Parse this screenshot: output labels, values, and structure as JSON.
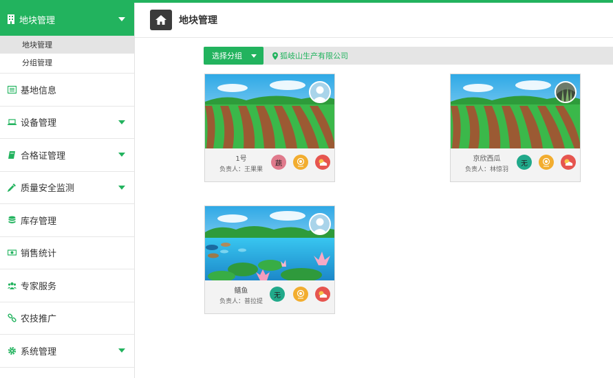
{
  "sidebar": {
    "active": {
      "label": "地块管理",
      "icon": "building-icon"
    },
    "submenu": [
      {
        "label": "地块管理"
      },
      {
        "label": "分组管理"
      }
    ],
    "items": [
      {
        "label": "基地信息",
        "icon": "list-icon",
        "has_caret": false
      },
      {
        "label": "设备管理",
        "icon": "laptop-icon",
        "has_caret": true
      },
      {
        "label": "合格证管理",
        "icon": "book-icon",
        "has_caret": true
      },
      {
        "label": "质量安全监测",
        "icon": "eyedropper-icon",
        "has_caret": true
      },
      {
        "label": "库存管理",
        "icon": "database-icon",
        "has_caret": false
      },
      {
        "label": "销售统计",
        "icon": "money-icon",
        "has_caret": false
      },
      {
        "label": "专家服务",
        "icon": "users-icon",
        "has_caret": false
      },
      {
        "label": "农技推广",
        "icon": "link-icon",
        "has_caret": false
      },
      {
        "label": "系统管理",
        "icon": "gear-icon",
        "has_caret": true
      }
    ]
  },
  "header": {
    "title": "地块管理",
    "home_icon": "home-icon"
  },
  "toolbar": {
    "group_button": "选择分组",
    "company": "狐岐山生产有限公司"
  },
  "cards": [
    {
      "name": "1号",
      "owner": "负责人：王果果",
      "badge": "蔬",
      "badge_color": "#e07a8c",
      "scene": "field",
      "avatar": "default"
    },
    {
      "name": "京欣西瓜",
      "owner": "负责人：林惊羽",
      "badge": "无",
      "badge_color": "#21a98a",
      "scene": "field",
      "avatar": "photo"
    },
    {
      "name": "鳝鱼",
      "owner": "负责人：普拉提",
      "badge": "无",
      "badge_color": "#21a98a",
      "scene": "pond",
      "avatar": "default"
    }
  ],
  "colors": {
    "accent": "#22b35e",
    "sidebar_border": "#e2e2e2"
  }
}
